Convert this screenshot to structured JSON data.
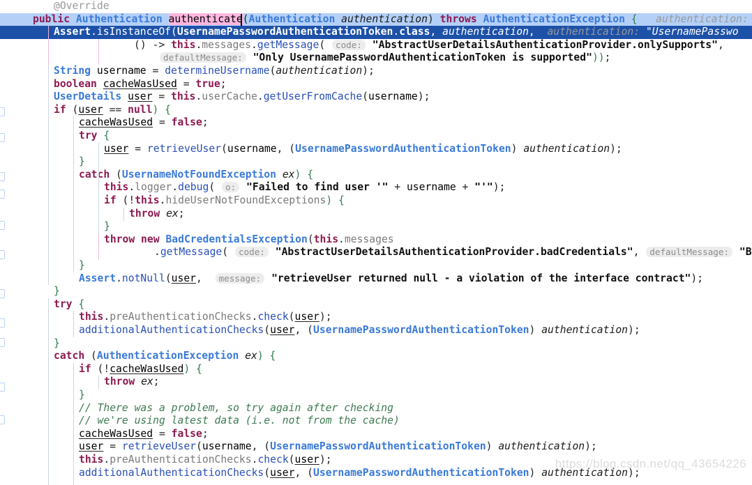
{
  "editor": {
    "language": "java",
    "theme": "IntelliJ Light",
    "colors": {
      "background": "#ffffff",
      "caret_line": "#b4d0f7",
      "selection": "#1d51a8",
      "search_match": "#ffb6e1",
      "keyword": "#000080",
      "keyword_modifier": "#8c1a52",
      "class_name": "#3a7ad8",
      "string": "#0f0f0f",
      "comment": "#3d7a52",
      "inlay_hint_bg": "#ededed",
      "inlay_hint_fg": "#8c8c8c",
      "indent_guide": "#cdd6e3",
      "indent_guide_active": "#f0b8d8"
    },
    "caret": {
      "line_index": 1,
      "after_token": "authenticate"
    },
    "search_highlight": "authenticate",
    "watermark": "https://blog.csdn.net/qq_43654226"
  },
  "code": {
    "lines": [
      {
        "n": 0,
        "text": "        @Override"
      },
      {
        "n": 1,
        "text": "        public Authentication authenticate(Authentication authentication) throws AuthenticationException {    authentication:"
      },
      {
        "n": 2,
        "text": "            Assert.isInstanceOf(UsernamePasswordAuthenticationToken.class, authentication,   authentication: \"UsernamePasswo"
      },
      {
        "n": 3,
        "text": "                    () -> this.messages.getMessage( code: \"AbstractUserDetailsAuthenticationProvider.onlySupports\","
      },
      {
        "n": 4,
        "text": "                            defaultMessage: \"Only UsernamePasswordAuthenticationToken is supported\"));"
      },
      {
        "n": 5,
        "text": "            String username = determineUsername(authentication);"
      },
      {
        "n": 6,
        "text": "            boolean cacheWasUsed = true;"
      },
      {
        "n": 7,
        "text": "            UserDetails user = this.userCache.getUserFromCache(username);"
      },
      {
        "n": 8,
        "text": "            if (user == null) {"
      },
      {
        "n": 9,
        "text": "                cacheWasUsed = false;"
      },
      {
        "n": 10,
        "text": "                try {"
      },
      {
        "n": 11,
        "text": "                    user = retrieveUser(username, (UsernamePasswordAuthenticationToken) authentication);"
      },
      {
        "n": 12,
        "text": "                }"
      },
      {
        "n": 13,
        "text": "                catch (UsernameNotFoundException ex) {"
      },
      {
        "n": 14,
        "text": "                    this.logger.debug( o: \"Failed to find user '\" + username + \"'\");"
      },
      {
        "n": 15,
        "text": "                    if (!this.hideUserNotFoundExceptions) {"
      },
      {
        "n": 16,
        "text": "                        throw ex;"
      },
      {
        "n": 17,
        "text": "                    }"
      },
      {
        "n": 18,
        "text": "                    throw new BadCredentialsException(this.messages"
      },
      {
        "n": 19,
        "text": "                            .getMessage( code: \"AbstractUserDetailsAuthenticationProvider.badCredentials\",  defaultMessage: \"Ba"
      },
      {
        "n": 20,
        "text": "                }"
      },
      {
        "n": 21,
        "text": "                Assert.notNull(user,  message: \"retrieveUser returned null - a violation of the interface contract\");"
      },
      {
        "n": 22,
        "text": "            }"
      },
      {
        "n": 23,
        "text": "            try {"
      },
      {
        "n": 24,
        "text": "                this.preAuthenticationChecks.check(user);"
      },
      {
        "n": 25,
        "text": "                additionalAuthenticationChecks(user, (UsernamePasswordAuthenticationToken) authentication);"
      },
      {
        "n": 26,
        "text": "            }"
      },
      {
        "n": 27,
        "text": "            catch (AuthenticationException ex) {"
      },
      {
        "n": 28,
        "text": "                if (!cacheWasUsed) {"
      },
      {
        "n": 29,
        "text": "                    throw ex;"
      },
      {
        "n": 30,
        "text": "                }"
      },
      {
        "n": 31,
        "text": "                // There was a problem, so try again after checking"
      },
      {
        "n": 32,
        "text": "                // we're using latest data (i.e. not from the cache)"
      },
      {
        "n": 33,
        "text": "                cacheWasUsed = false;"
      },
      {
        "n": 34,
        "text": "                user = retrieveUser(username, (UsernamePasswordAuthenticationToken) authentication);"
      },
      {
        "n": 35,
        "text": "                this.preAuthenticationChecks.check(user);"
      },
      {
        "n": 36,
        "text": "                additionalAuthenticationChecks(user, (UsernamePasswordAuthenticationToken) authentication);"
      }
    ],
    "inlay_hints": [
      "authentication:",
      "code:",
      "defaultMessage:",
      "o:",
      "message:"
    ],
    "strings": [
      "\"AbstractUserDetailsAuthenticationProvider.onlySupports\"",
      "\"Only UsernamePasswordAuthenticationToken is supported\"",
      "\"Failed to find user '\"",
      "\"'\"",
      "\"AbstractUserDetailsAuthenticationProvider.badCredentials\"",
      "\"retrieveUser returned null - a violation of the interface contract\"",
      "\"UsernamePasswo"
    ],
    "comments": [
      "// There was a problem, so try again after checking",
      "// we're using latest data (i.e. not from the cache)"
    ]
  }
}
